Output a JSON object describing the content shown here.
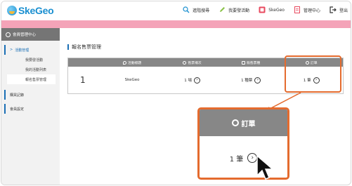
{
  "brand": {
    "name": "SkeGeo"
  },
  "nav": [
    {
      "label": "進階搜尋",
      "icon": "search-icon"
    },
    {
      "label": "我要發活動",
      "icon": "pencil-icon"
    },
    {
      "label": "SkeGeo",
      "icon": "skegeo-app-icon"
    },
    {
      "label": "管理中心",
      "icon": "document-icon"
    },
    {
      "label": "登出",
      "icon": "logout-icon"
    }
  ],
  "sidebar": {
    "header": "會員管理中心",
    "items": [
      {
        "label": "活動管理",
        "type": "main"
      },
      {
        "label": "我要發活動",
        "type": "sub"
      },
      {
        "label": "我的活動列表",
        "type": "sub"
      },
      {
        "label": "報名售票管理",
        "type": "sub",
        "active": true
      },
      {
        "label": "購買記錄",
        "type": "main"
      },
      {
        "label": "會員設定",
        "type": "main"
      }
    ]
  },
  "page": {
    "title": "報名售票管理"
  },
  "table": {
    "headers": [
      "",
      "活動標題",
      "售票場次",
      "販售票種",
      "訂單"
    ],
    "row": {
      "index": "1",
      "title": "SkeGeo",
      "sessions": "1 場",
      "ticket_types": "1 種票",
      "orders": "1 筆"
    }
  },
  "zoom": {
    "header": "訂單",
    "value": "1 筆"
  },
  "colors": {
    "accent": "#1a6fb5",
    "highlight": "#e46b2e",
    "banner": "#f4a3b8",
    "table_header": "#878787"
  }
}
